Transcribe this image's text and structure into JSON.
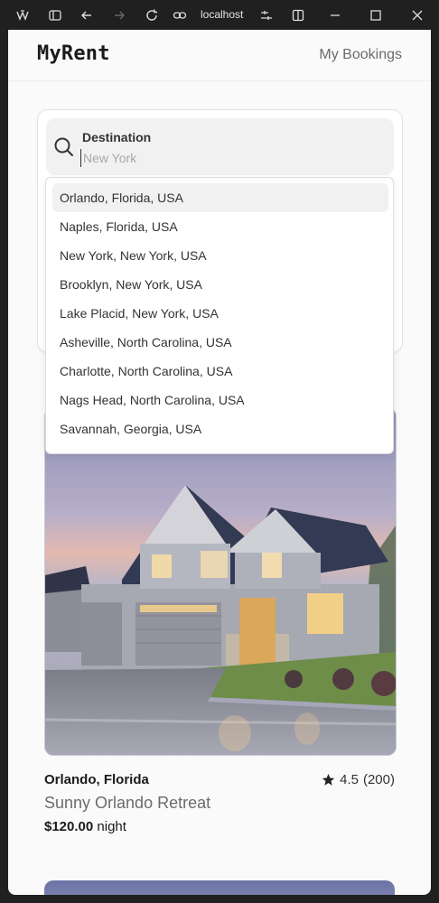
{
  "browser": {
    "url": "localhost"
  },
  "header": {
    "logo": "MyRent",
    "nav_link": "My Bookings"
  },
  "search": {
    "label": "Destination",
    "placeholder": "New York",
    "value": ""
  },
  "suggestions": [
    {
      "label": "Orlando, Florida, USA",
      "highlighted": true
    },
    {
      "label": "Naples, Florida, USA",
      "highlighted": false
    },
    {
      "label": "New York, New York, USA",
      "highlighted": false
    },
    {
      "label": "Brooklyn, New York, USA",
      "highlighted": false
    },
    {
      "label": "Lake Placid, New York, USA",
      "highlighted": false
    },
    {
      "label": "Asheville, North Carolina, USA",
      "highlighted": false
    },
    {
      "label": "Charlotte, North Carolina, USA",
      "highlighted": false
    },
    {
      "label": "Nags Head, North Carolina, USA",
      "highlighted": false
    },
    {
      "label": "Savannah, Georgia, USA",
      "highlighted": false
    }
  ],
  "listing": {
    "location": "Orlando, Florida",
    "rating": "4.5",
    "review_count": "(200)",
    "title": "Sunny Orlando Retreat",
    "price": "$120.00",
    "price_unit": "night"
  },
  "colors": {
    "background": "#fafafa",
    "chrome": "#202020",
    "field": "#f1f1f1"
  }
}
